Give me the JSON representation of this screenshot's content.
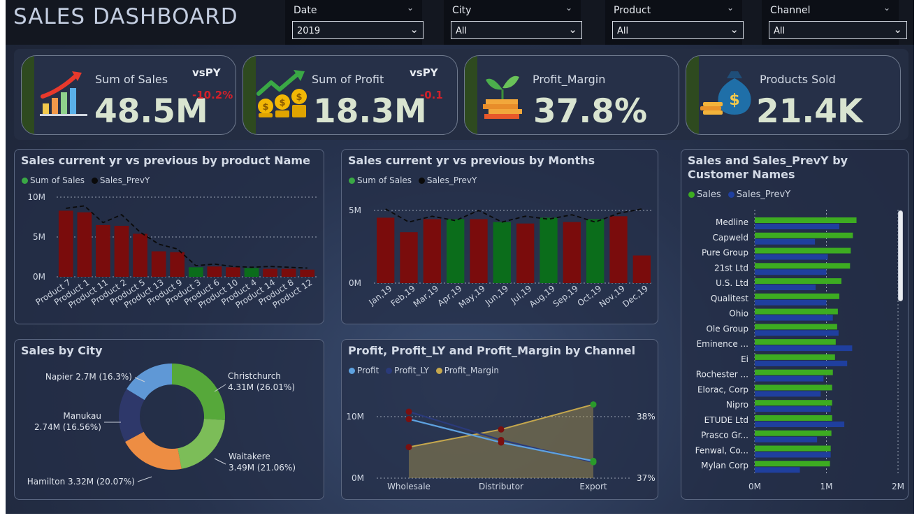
{
  "header": {
    "title": "SALES  DASHBOARD",
    "slicers": [
      {
        "label": "Date",
        "value": "2019"
      },
      {
        "label": "City",
        "value": "All"
      },
      {
        "label": "Product",
        "value": "All"
      },
      {
        "label": "Channel",
        "value": "All"
      }
    ]
  },
  "kpis": [
    {
      "name": "Sum of Sales",
      "value": "48.5M",
      "vs_label": "vsPY",
      "delta": "-10.2%"
    },
    {
      "name": "Sum of Profit",
      "value": "18.3M",
      "vs_label": "vsPY",
      "delta": "-0.1"
    },
    {
      "name": "Profit_Margin",
      "value": "37.8%"
    },
    {
      "name": "Products Sold",
      "value": "21.4K"
    }
  ],
  "colors": {
    "green": "#2f9e2f",
    "dark_red": "#7a0c0c",
    "dark_green": "#0b6d1b",
    "navy": "#1f3f9e",
    "bright_green": "#3dac21",
    "profit_blue": "#5ea2e0",
    "profit_ly": "#2a3a7a",
    "margin_gold": "#c5a74d"
  },
  "chart_data": [
    {
      "id": "product_chart",
      "type": "bar",
      "title": "Sales current yr vs previous by product Name",
      "legend": [
        "Sum of Sales",
        "Sales_PrevY"
      ],
      "y_ticks": [
        "10M",
        "5M",
        "0M"
      ],
      "ylim": [
        0,
        10
      ],
      "categories": [
        "Product 7",
        "Product 11",
        "Product 2",
        "Product 13",
        "Product 5",
        "Product 9",
        "Product 3",
        "Product 6",
        "Product 10",
        "Product 4",
        "Product 14",
        "Product 8",
        "Product 12"
      ],
      "x_labels_shown": [
        "Product 7",
        "Product 1",
        "Product 11",
        "Product 2",
        "Product 5",
        "Product 13",
        "Product 9",
        "Product 3",
        "Product 6",
        "Product 10",
        "Product 4",
        "Product 14",
        "Product 8",
        "Product 12"
      ],
      "series": [
        {
          "name": "Sum of Sales",
          "values": [
            8.3,
            8.1,
            6.5,
            6.4,
            5.4,
            3.2,
            3.1,
            1.2,
            1.3,
            1.2,
            1.1,
            1.0,
            1.0,
            0.9
          ]
        },
        {
          "name": "Sales_PrevY",
          "values": [
            8.6,
            8.9,
            6.8,
            7.8,
            5.6,
            4.1,
            3.5,
            1.4,
            1.6,
            1.3,
            1.2,
            1.3,
            1.2,
            1.1
          ]
        }
      ],
      "bar_colors": [
        "dark_red",
        "dark_red",
        "dark_red",
        "dark_red",
        "dark_red",
        "dark_red",
        "dark_red",
        "dark_green",
        "dark_red",
        "dark_red",
        "dark_green",
        "dark_red",
        "dark_red",
        "dark_red"
      ]
    },
    {
      "id": "month_chart",
      "type": "bar",
      "title": "Sales current yr vs previous by Months",
      "legend": [
        "Sum of Sales",
        "Sales_PrevY"
      ],
      "y_ticks": [
        "5M",
        "0M"
      ],
      "ylim": [
        0,
        5
      ],
      "categories": [
        "Jan,19",
        "Feb,19",
        "Mar,19",
        "Apr,19",
        "May,19",
        "Jun,19",
        "Jul,19",
        "Aug,19",
        "Sep,19",
        "Oct,19",
        "Nov,19",
        "Dec,19"
      ],
      "series": [
        {
          "name": "Sum of Sales",
          "values": [
            4.5,
            3.5,
            4.4,
            4.4,
            4.4,
            4.2,
            4.1,
            4.5,
            4.2,
            4.4,
            4.6,
            1.9
          ]
        },
        {
          "name": "Sales_PrevY",
          "values": [
            5.1,
            4.2,
            4.6,
            4.3,
            5.0,
            4.2,
            4.6,
            4.4,
            4.7,
            4.2,
            4.8,
            5.1
          ]
        }
      ],
      "bar_colors": [
        "dark_red",
        "dark_red",
        "dark_red",
        "dark_green",
        "dark_red",
        "dark_green",
        "dark_red",
        "dark_green",
        "dark_red",
        "dark_green",
        "dark_red",
        "dark_red"
      ]
    },
    {
      "id": "city_chart",
      "type": "pie",
      "title": "Sales by City",
      "slices": [
        {
          "name": "Christchurch",
          "value": 4.31,
          "label_line1": "Christchurch",
          "label_line2": "4.31M (26.01%)",
          "pct": 26.01,
          "color": "#56a83a"
        },
        {
          "name": "Waitakere",
          "value": 3.49,
          "label_line1": "Waitakere",
          "label_line2": "3.49M (21.06%)",
          "pct": 21.06,
          "color": "#7cbd58"
        },
        {
          "name": "Hamilton",
          "value": 3.32,
          "label_line1": "Hamilton 3.32M (20.07%)",
          "label_line2": "",
          "pct": 20.07,
          "color": "#ed8d43"
        },
        {
          "name": "Manukau",
          "value": 2.74,
          "label_line1": "Manukau",
          "label_line2": "2.74M (16.56%)",
          "pct": 16.56,
          "color": "#2e386a"
        },
        {
          "name": "Napier",
          "value": 2.7,
          "label_line1": "Napier 2.7M (16.3%)",
          "label_line2": "",
          "pct": 16.3,
          "color": "#5f98d6"
        }
      ]
    },
    {
      "id": "channel_chart",
      "type": "line",
      "title": "Profit, Profit_LY and Profit_Margin by Channel",
      "legend": [
        "Profit",
        "Profit_LY",
        "Profit_Margin"
      ],
      "categories": [
        "Wholesale",
        "Distributor",
        "Export"
      ],
      "y_ticks": [
        "10M",
        "0M"
      ],
      "y2_ticks": [
        "38%",
        "37%"
      ],
      "ylim": [
        0,
        10
      ],
      "y2lim": [
        36.99,
        38.0
      ],
      "series": [
        {
          "name": "Profit",
          "values": [
            9.6,
            5.8,
            2.8
          ]
        },
        {
          "name": "Profit_LY",
          "values": [
            10.8,
            6.2,
            2.6
          ]
        },
        {
          "name": "Profit_Margin",
          "values": [
            37.5,
            37.79,
            38.2
          ]
        }
      ]
    },
    {
      "id": "customer_chart",
      "type": "bar",
      "title": "Sales and Sales_PrevY by Customer Names",
      "legend": [
        "Sales",
        "Sales_PrevY"
      ],
      "x_ticks": [
        "0M",
        "1M",
        "2M"
      ],
      "xlim": [
        0,
        2
      ],
      "categories": [
        "Medline",
        "Capweld",
        "Pure Group",
        "21st Ltd",
        "U.S. Ltd",
        "Qualitest",
        "Ohio",
        "Ole Group",
        "Eminence ...",
        "Ei",
        "Rochester ...",
        "Elorac, Corp",
        "Nipro",
        "ETUDE Ltd",
        "Prasco Gr...",
        "Fenwal, Co...",
        "Mylan Corp"
      ],
      "series": [
        {
          "name": "Sales",
          "values": [
            1.42,
            1.37,
            1.34,
            1.33,
            1.21,
            1.18,
            1.16,
            1.15,
            1.13,
            1.12,
            1.09,
            1.08,
            1.08,
            1.08,
            1.07,
            1.06,
            1.05
          ]
        },
        {
          "name": "Sales_PrevY",
          "values": [
            1.18,
            0.84,
            1.02,
            1.0,
            0.85,
            1.0,
            1.09,
            1.17,
            1.36,
            1.29,
            0.96,
            0.92,
            1.06,
            1.25,
            0.87,
            1.06,
            0.63
          ]
        }
      ]
    }
  ]
}
